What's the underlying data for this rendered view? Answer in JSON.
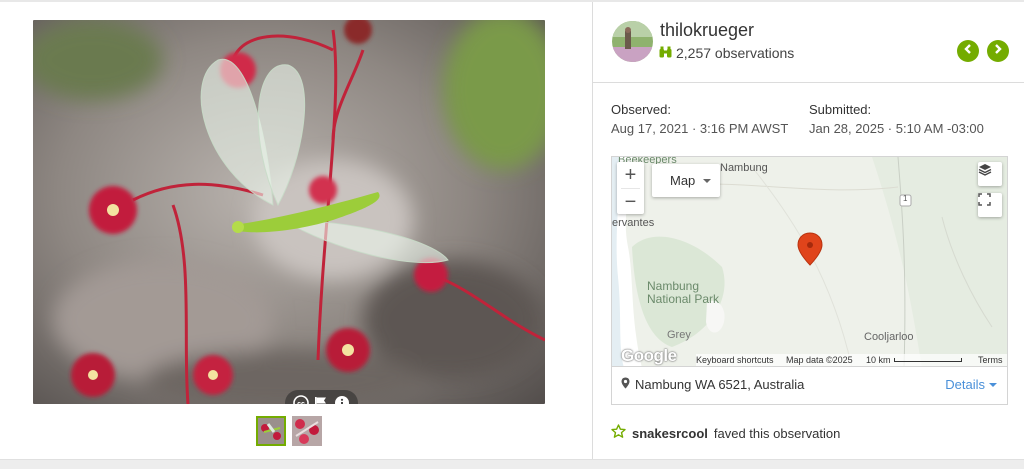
{
  "observer": {
    "username": "thilokrueger",
    "observation_count": "2,257 observations"
  },
  "observed": {
    "label": "Observed:",
    "value": "Aug 17, 2021 · 3:16 PM AWST"
  },
  "submitted": {
    "label": "Submitted:",
    "value": "Jan 28, 2025 · 5:10 AM -03:00"
  },
  "map": {
    "type_label": "Map",
    "zoom_in": "+",
    "zoom_out": "−",
    "labels": {
      "beekeepers": "Beekeepers",
      "nambung_top": "Nambung",
      "cervantes": "ervantes",
      "park_line1": "Nambung",
      "park_line2": "National Park",
      "grey": "Grey",
      "cooljarloo": "Cooljarloo",
      "road_marker": "1"
    },
    "footer": {
      "google": "Google",
      "shortcuts": "Keyboard shortcuts",
      "data": "Map data ©2025",
      "scale": "10 km",
      "terms": "Terms"
    }
  },
  "place": "Nambung WA 6521, Australia",
  "details_label": "Details",
  "fave": {
    "user": "snakesrcool",
    "text": "faved this observation"
  },
  "colors": {
    "accent": "#74ac00",
    "link": "#4a90d9",
    "marker": "#e0441b"
  },
  "icons": [
    "cc-icon",
    "flag-icon",
    "info-icon",
    "binoculars-icon",
    "chevron-left-icon",
    "chevron-right-icon",
    "layers-icon",
    "fullscreen-icon",
    "map-pin-icon",
    "star-icon"
  ]
}
